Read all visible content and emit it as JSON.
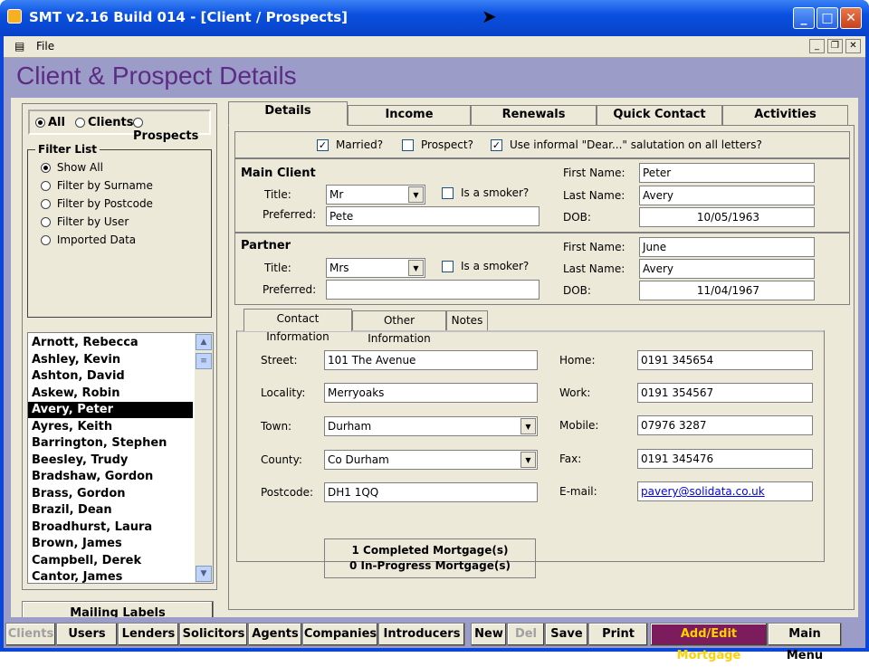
{
  "window": {
    "title": "SMT v2.16 Build 014 - [Client / Prospects]"
  },
  "menu": {
    "file": "File"
  },
  "header": {
    "title": "Client & Prospect Details"
  },
  "radio_group": {
    "all": "All",
    "clients": "Clients",
    "prospects": "Prospects"
  },
  "filter": {
    "legend": "Filter List",
    "items": [
      "Show All",
      "Filter by Surname",
      "Filter by Postcode",
      "Filter by User",
      "Imported Data"
    ]
  },
  "list": {
    "items": [
      "Arnott, Rebecca",
      "Ashley, Kevin",
      "Ashton, David",
      "Askew, Robin",
      "Avery, Peter",
      "Ayres, Keith",
      "Barrington, Stephen",
      "Beesley, Trudy",
      "Bradshaw, Gordon",
      "Brass, Gordon",
      "Brazil, Dean",
      "Broadhurst, Laura",
      "Brown, James",
      "Campbell, Derek",
      "Cantor, James"
    ],
    "selected_index": 4
  },
  "mailing_labels": "Mailing Labels",
  "tabs": [
    "Details",
    "Income",
    "Renewals",
    "Quick Contact",
    "Activities"
  ],
  "flags": {
    "married": "Married?",
    "prospect": "Prospect?",
    "informal": "Use informal \"Dear...\" salutation on all letters?"
  },
  "main_client": {
    "heading": "Main Client",
    "title_label": "Title:",
    "title": "Mr",
    "smoker_label": "Is a smoker?",
    "preferred_label": "Preferred:",
    "preferred": "Pete",
    "first_label": "First Name:",
    "first": "Peter",
    "last_label": "Last Name:",
    "last": "Avery",
    "dob_label": "DOB:",
    "dob": "10/05/1963"
  },
  "partner": {
    "heading": "Partner",
    "title_label": "Title:",
    "title": "Mrs",
    "smoker_label": "Is a smoker?",
    "preferred_label": "Preferred:",
    "preferred": "",
    "first_label": "First Name:",
    "first": "June",
    "last_label": "Last Name:",
    "last": "Avery",
    "dob_label": "DOB:",
    "dob": "11/04/1967"
  },
  "subtabs": [
    "Contact Information",
    "Other Information",
    "Notes"
  ],
  "contact": {
    "street_label": "Street:",
    "street": "101 The Avenue",
    "locality_label": "Locality:",
    "locality": "Merryoaks",
    "town_label": "Town:",
    "town": "Durham",
    "county_label": "County:",
    "county": "Co Durham",
    "postcode_label": "Postcode:",
    "postcode": "DH1 1QQ",
    "home_label": "Home:",
    "home": "0191 345654",
    "work_label": "Work:",
    "work": "0191 354567",
    "mobile_label": "Mobile:",
    "mobile": "07976 3287",
    "fax_label": "Fax:",
    "fax": "0191 345476",
    "email_label": "E-mail:",
    "email": "pavery@solidata.co.uk"
  },
  "mortgages": {
    "completed": "1 Completed Mortgage(s)",
    "in_progress": "0 In-Progress Mortgage(s)"
  },
  "bottom": {
    "clients": "Clients",
    "users": "Users",
    "lenders": "Lenders",
    "solicitors": "Solicitors",
    "agents": "Agents",
    "companies": "Companies",
    "introducers": "Introducers",
    "new": "New",
    "del": "Del",
    "save": "Save",
    "print": "Print",
    "add_edit": "Add/Edit Mortgage",
    "main_menu": "Main Menu"
  },
  "colors": {
    "title_accent": "#5c2c84",
    "add_edit_bg": "#7c1c5c",
    "add_edit_fg": "#ffd000"
  }
}
